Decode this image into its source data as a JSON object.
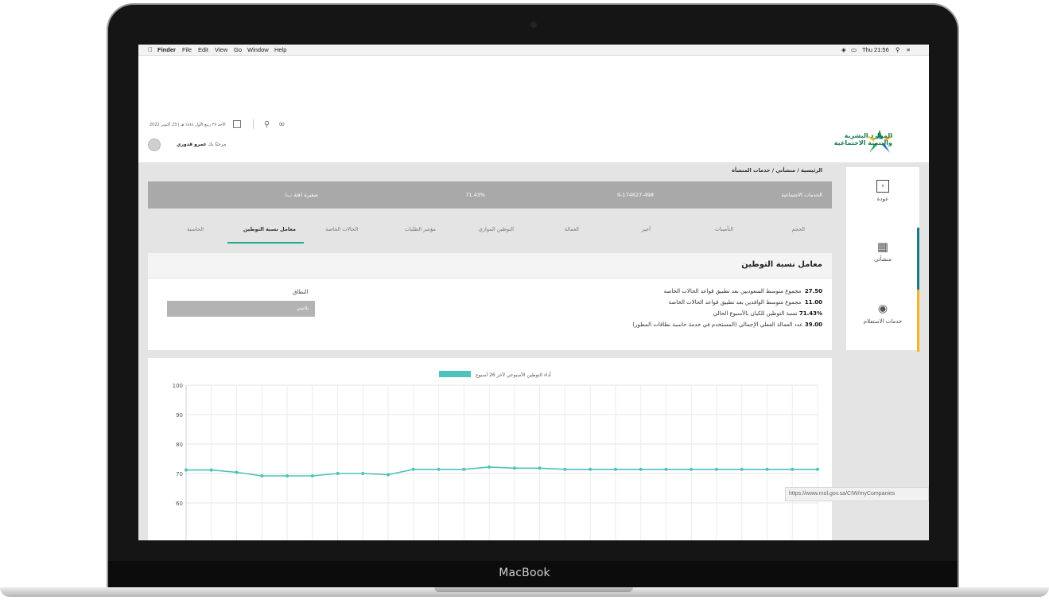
{
  "device": {
    "brand": "MacBook"
  },
  "menubar": {
    "app": "Finder",
    "items": [
      "File",
      "Edit",
      "View",
      "Go",
      "Window",
      "Help"
    ],
    "clock": "Thu 21:56"
  },
  "header": {
    "logo_line1": "الموارد البشرية",
    "logo_line2": "والتنمية الاجتماعية",
    "date": "الأحد ٢٧ ربيع الأول ١٤٤٤ هـ | 23 أكتوبر 2022",
    "greeting_prefix": "مرحبًا بك",
    "user_name": "عمرو قدوري"
  },
  "sidebar": {
    "back_label": "عودة",
    "mine_label": "منشأتي",
    "query_label": "خدمات الاستعلام"
  },
  "breadcrumb": "الرئيسية / منشأتي / خدمات المنشأة",
  "info_bar": {
    "name": "الخدمات الاجتماعية",
    "id": "9-174627-498",
    "percent": "71.43%",
    "category": "صغيرة (فئة ب)"
  },
  "tabs": [
    "الحجم",
    "التأمينات",
    "أجير",
    "العمالة",
    "التوطين الموازي",
    "مؤشر الطلبات",
    "الحالات الخاصة",
    "معامل نسبة التوطين",
    "الحاسبة"
  ],
  "active_tab": "معامل نسبة التوطين",
  "panel": {
    "title": "معامل نسبة التوطين",
    "stats": [
      {
        "value": "27.50",
        "text": "مجموع متوسط السعوديين بعد تطبيق قواعد الحالات الخاصة"
      },
      {
        "value": "11.00",
        "text": "مجموع متوسط الوافدين بعد تطبيق قواعد الحالات الخاصة"
      },
      {
        "value": "71.43%",
        "text": "نسبة التوطين للكيان بالأسبوع الحالي"
      },
      {
        "value": "39.00",
        "text": "عدد العمالة الفعلي الإجمالي (المستخدم في خدمة حاسبة نطاقات المطور)"
      }
    ],
    "range_label": "النطاق",
    "range_value": "بلاتيني"
  },
  "status_url": "https://www.mol.gov.sa/CIW/myCompanies",
  "colors": {
    "accent_green": "#23a889",
    "line": "#4cc3bd",
    "teal": "#1a7d86",
    "yellow": "#f2b51f"
  },
  "chart_data": {
    "type": "line",
    "legend": "أداء التوطين الأسبوعي لآخر 26 أسبوع",
    "y_ticks": [
      100,
      90,
      80,
      70,
      60
    ],
    "ylim": [
      60,
      100
    ],
    "series": [
      {
        "name": "أداء التوطين الأسبوعي لآخر 26 أسبوع",
        "values": [
          71.2,
          71.2,
          70.4,
          69.2,
          69.2,
          69.2,
          70.0,
          70.0,
          69.6,
          71.4,
          71.4,
          71.4,
          72.2,
          71.8,
          71.8,
          71.4,
          71.4,
          71.4,
          71.4,
          71.4,
          71.4,
          71.4,
          71.4,
          71.4,
          71.4,
          71.4
        ]
      }
    ]
  }
}
